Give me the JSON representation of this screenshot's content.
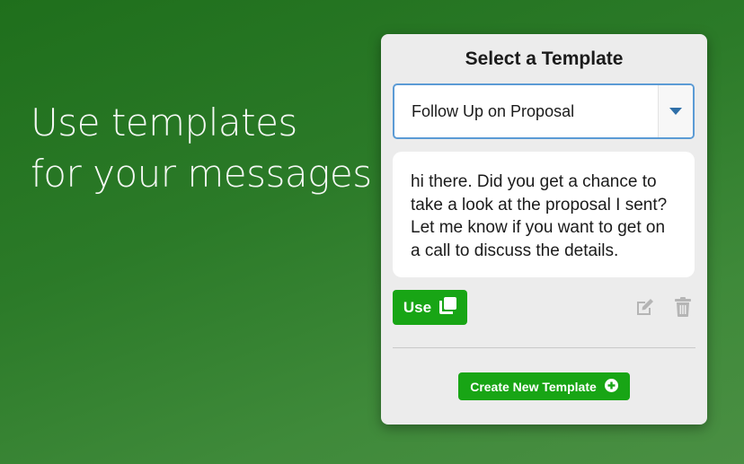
{
  "headline": {
    "line1": "Use templates",
    "line2": "for your messages"
  },
  "panel": {
    "title": "Select a Template",
    "select": {
      "selected_value": "Follow Up on Proposal",
      "arrow_icon": "caret-down-icon"
    },
    "message_text": "hi there. Did you get a chance to take a look at the proposal I sent? Let me know if you want to get on a call to discuss the details.",
    "use_button": {
      "label": "Use",
      "icon": "copy-icon"
    },
    "edit_icon": "edit-icon",
    "delete_icon": "trash-icon",
    "create_button": {
      "label": "Create New Template",
      "icon": "plus-circle-icon"
    }
  },
  "colors": {
    "background_start": "#1f6f1c",
    "background_end": "#4a8f43",
    "panel_background": "#ececec",
    "accent_green": "#18a515",
    "select_border": "#5b9bd5",
    "caret": "#2f6fa8",
    "disabled_icon": "#b5b5b5"
  }
}
